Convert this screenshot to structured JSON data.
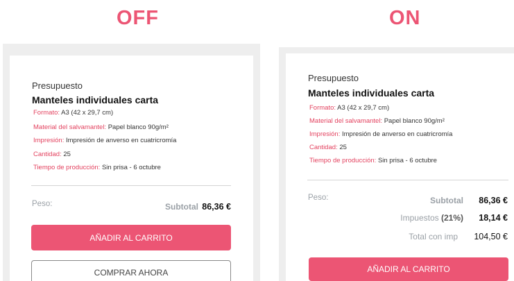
{
  "headings": {
    "off": "OFF",
    "on": "ON"
  },
  "colors": {
    "accent": "#ec5574",
    "attr_key": "#e3425f",
    "muted": "#9aa0a6",
    "panel_bg": "#eeeeee"
  },
  "left": {
    "presupuesto": "Presupuesto",
    "title": "Manteles individuales carta",
    "attributes": [
      {
        "key": "Formato:",
        "value": "A3 (42 x 29,7 cm)"
      },
      {
        "key": "Material del salvamantel:",
        "value": "Papel blanco 90g/m²"
      },
      {
        "key": "Impresión:",
        "value": "Impresión de anverso en cuatricromía"
      },
      {
        "key": "Cantidad:",
        "value": "25"
      },
      {
        "key": "Tiempo de producción:",
        "value": "Sin prisa - 6 octubre"
      }
    ],
    "peso_label": "Peso:",
    "subtotal_label": "Subtotal",
    "subtotal_value": "86,36 €",
    "add_to_cart": "AÑADIR AL CARRITO",
    "buy_now": "COMPRAR AHORA"
  },
  "right": {
    "presupuesto": "Presupuesto",
    "title": "Manteles individuales carta",
    "attributes": [
      {
        "key": "Formato:",
        "value": "A3 (42 x 29,7 cm)"
      },
      {
        "key": "Material del salvamantel:",
        "value": "Papel blanco 90g/m²"
      },
      {
        "key": "Impresión:",
        "value": "Impresión de anverso en cuatricromía"
      },
      {
        "key": "Cantidad:",
        "value": "25"
      },
      {
        "key": "Tiempo de producción:",
        "value": "Sin prisa - 6 octubre"
      }
    ],
    "peso_label": "Peso:",
    "subtotal_label": "Subtotal",
    "subtotal_value": "86,36 €",
    "tax_label": "Impuestos",
    "tax_pct": "(21%)",
    "tax_value": "18,14 €",
    "total_label": "Total con imp",
    "total_value": "104,50 €",
    "add_to_cart": "AÑADIR AL CARRITO"
  }
}
